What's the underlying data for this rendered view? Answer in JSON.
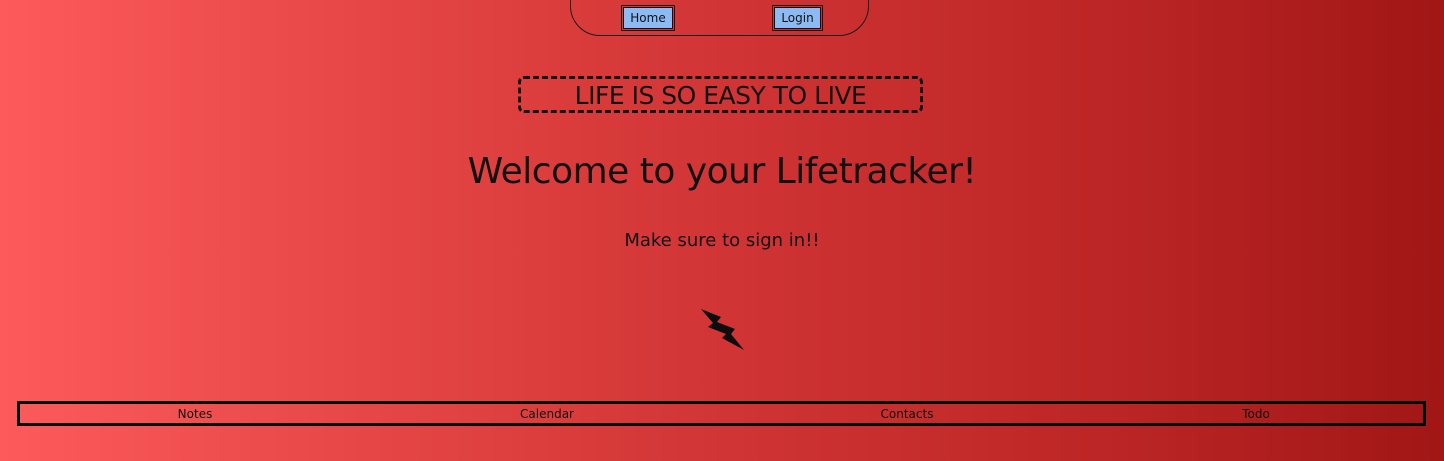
{
  "nav": {
    "home_label": "Home",
    "login_label": "Login",
    "button_color": "#8cbbf3"
  },
  "hero": {
    "motto": "LIFE IS SO EASY TO LIVE",
    "welcome": "Welcome to your Lifetracker!",
    "signin_note": "Make sure to sign in!!",
    "icon": "lightning-bolt-icon"
  },
  "footer": {
    "links": [
      {
        "label": "Notes"
      },
      {
        "label": "Calendar"
      },
      {
        "label": "Contacts"
      },
      {
        "label": "Todo"
      }
    ]
  },
  "theme": {
    "gradient_start": "#fd5b5b",
    "gradient_end": "#a11616"
  }
}
